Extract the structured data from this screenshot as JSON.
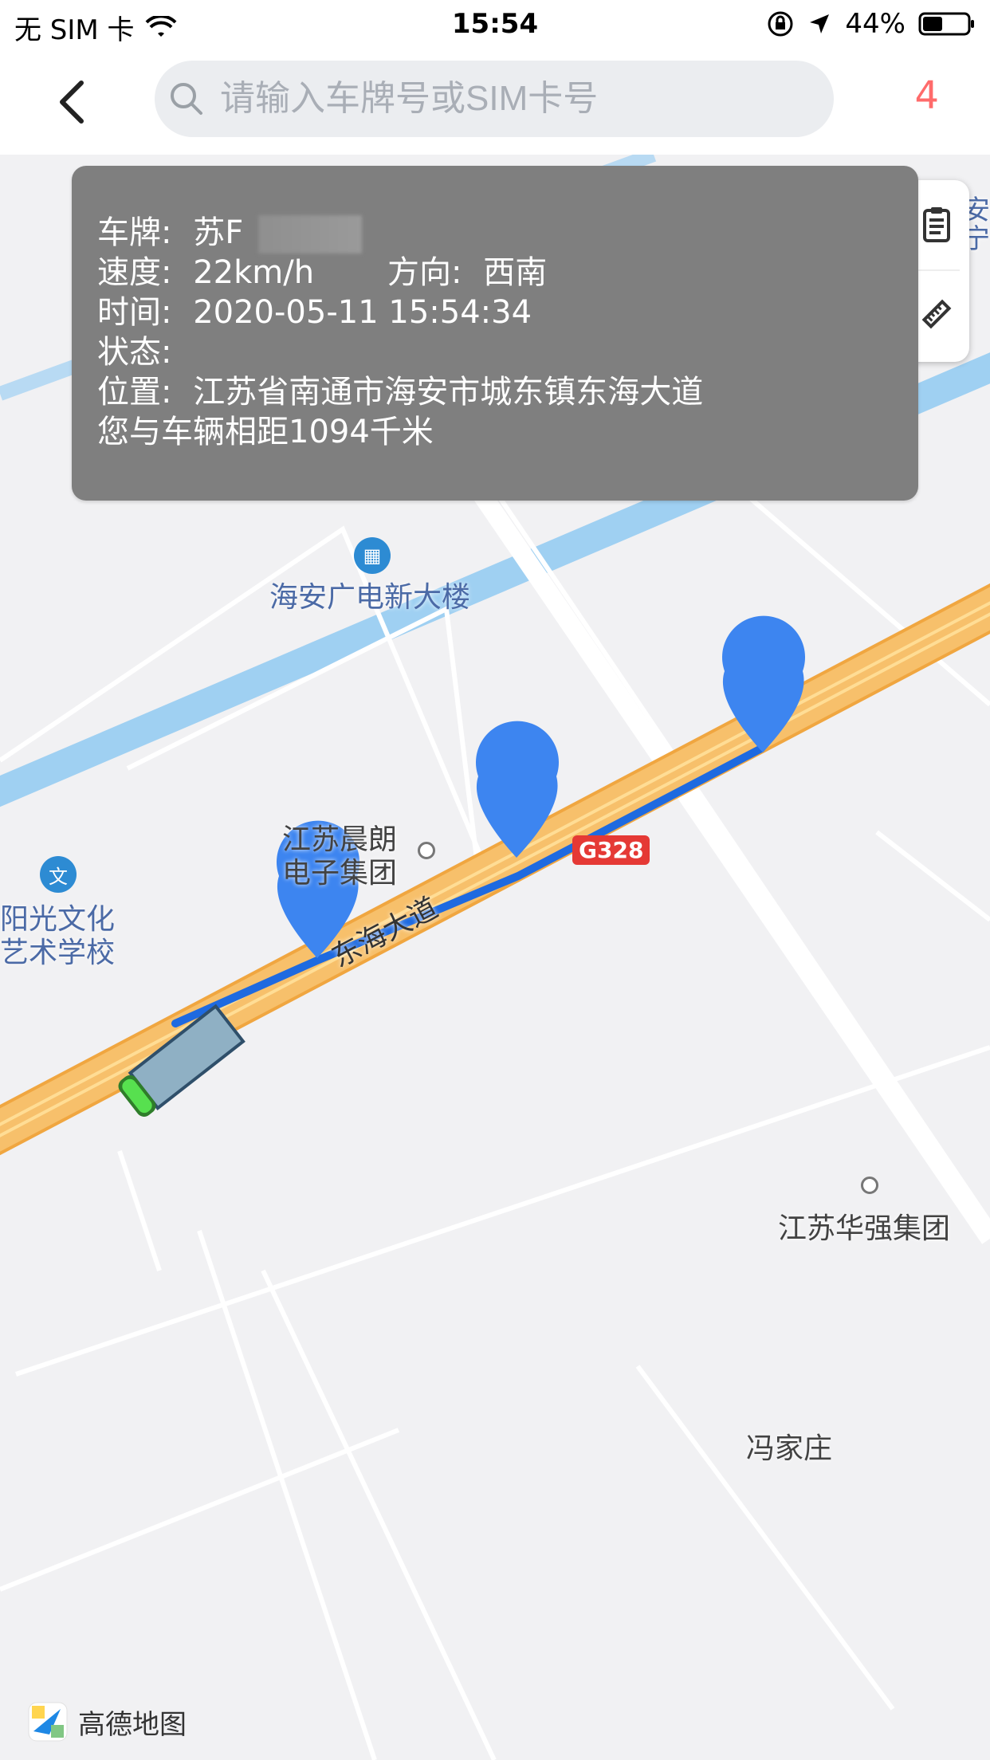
{
  "status_bar": {
    "carrier": "无 SIM 卡",
    "time": "15:54",
    "battery_percent": "44%",
    "battery_level": 0.44
  },
  "nav": {
    "search_placeholder": "请输入车牌号或SIM卡号",
    "count": "4"
  },
  "info_panel": {
    "plate_label": "车牌:",
    "plate_value": "苏F",
    "speed_label": "速度:",
    "speed_value": "22km/h",
    "direction_label": "方向:",
    "direction_value": "西南",
    "time_label": "时间:",
    "time_value": "2020-05-11 15:54:34",
    "status_label": "状态:",
    "status_value": "",
    "location_label": "位置:",
    "location_value": "江苏省南通市海安市城东镇东海大道",
    "distance_text": "您与车辆相距1094千米"
  },
  "map": {
    "labels": {
      "haian_building": "海安广电新大楼",
      "chenlang_group_line1": "江苏晨朗",
      "chenlang_group_line2": "电子集团",
      "yangguang_school_line1": "阳光文化",
      "yangguang_school_line2": "艺术学校",
      "huaqiang_group": "江苏华强集团",
      "fengjiazhuang": "冯家庄",
      "donghai_road": "东海大道",
      "road_badge": "G328",
      "top_right_partial_line1": "海安",
      "top_right_partial_line2": "泰宁"
    },
    "colors": {
      "road_main": "#f7c06b",
      "road_edge": "#f0a640",
      "route": "#1e6ae0",
      "marker": "#3d85f0",
      "water": "#9fd0f2",
      "minor_road": "#ffffff"
    }
  },
  "footer": {
    "amap_name": "高德地图"
  }
}
